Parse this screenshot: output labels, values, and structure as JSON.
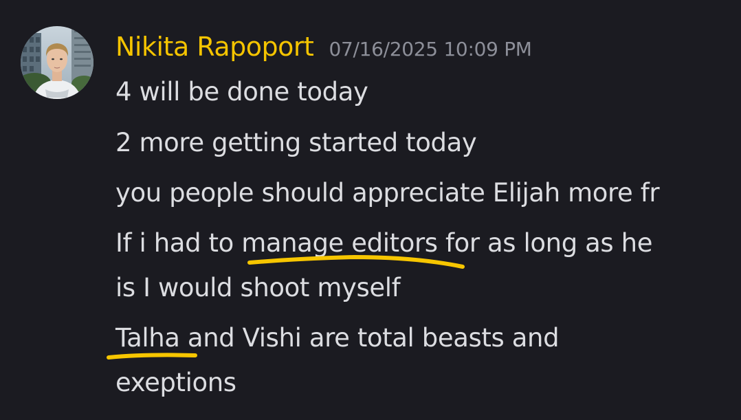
{
  "message": {
    "author": "Nikita Rapoport",
    "timestamp": "07/16/2025 10:09 PM",
    "lines": [
      "4 will be done today",
      "2 more getting started today",
      "you people should appreciate Elijah more fr",
      "If i had to manage editors for as long as he",
      "is I would shoot myself",
      "Talha and Vishi are total beasts and",
      "exeptions"
    ],
    "highlights": [
      "manage editors",
      "Talha"
    ]
  },
  "colors": {
    "background": "#1b1b21",
    "username": "#f5c400",
    "timestamp": "#8d8f99",
    "text": "#dcdde1",
    "underline": "#f7c600"
  },
  "icons": {
    "avatar": "user-avatar-photo"
  }
}
